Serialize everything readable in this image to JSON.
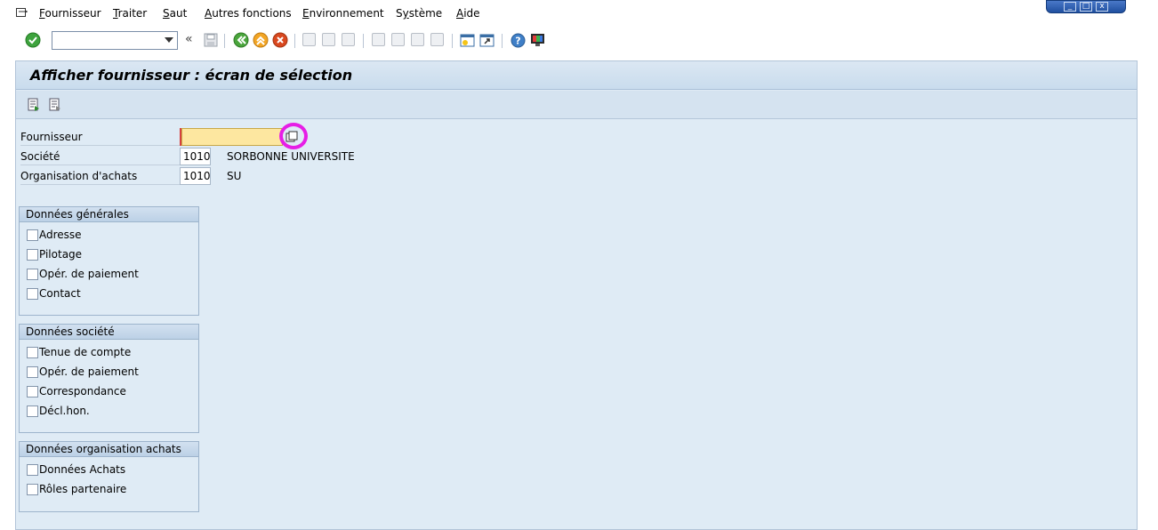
{
  "menubar": {
    "items": [
      "Fournisseur",
      "Traiter",
      "Saut",
      "Autres fonctions",
      "Environnement",
      "Système",
      "Aide"
    ],
    "mnemonics": [
      "F",
      "T",
      "S",
      "A",
      "E",
      "y",
      "A"
    ]
  },
  "toolbar": {
    "command_field_value": "",
    "back_chevrons": "«"
  },
  "screen": {
    "title": "Afficher fournisseur : écran de sélection"
  },
  "fields": {
    "supplier": {
      "label": "Fournisseur",
      "value": ""
    },
    "company": {
      "label": "Société",
      "value": "1010",
      "description": "SORBONNE UNIVERSITE"
    },
    "purch_org": {
      "label": "Organisation d'achats",
      "value": "1010",
      "description": "SU"
    }
  },
  "groups": {
    "general": {
      "title": "Données générales",
      "items": [
        "Adresse",
        "Pilotage",
        "Opér. de paiement",
        "Contact"
      ]
    },
    "company": {
      "title": "Données société",
      "items": [
        "Tenue de compte",
        "Opér. de paiement",
        "Correspondance",
        "Décl.hon."
      ]
    },
    "purchasing": {
      "title": "Données organisation achats",
      "items": [
        "Données Achats",
        "Rôles partenaire"
      ]
    }
  },
  "colors": {
    "background": "#dfebf5",
    "required_field": "#fde7a0",
    "highlight_ring": "#e61ee6"
  }
}
